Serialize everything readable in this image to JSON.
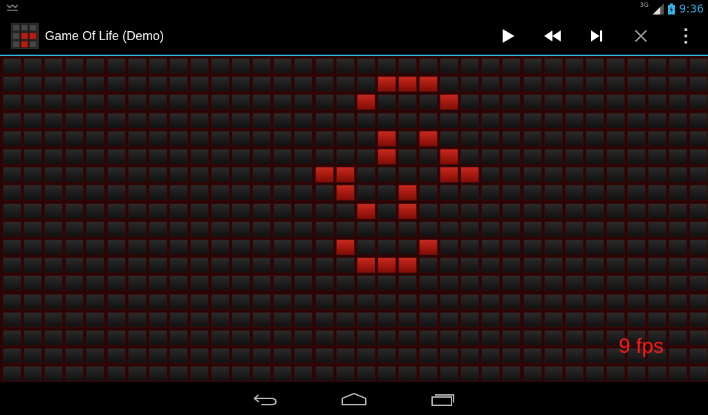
{
  "status_bar": {
    "network": "3G",
    "time": "9:36",
    "icons": [
      "download-icon",
      "signal-icon",
      "battery-charging-icon"
    ]
  },
  "action_bar": {
    "app_icon": "game-of-life-icon",
    "title": "Game Of Life (Demo)",
    "actions": [
      {
        "name": "play",
        "icon": "play-icon"
      },
      {
        "name": "rewind",
        "icon": "rewind-icon"
      },
      {
        "name": "step",
        "icon": "skip-next-icon"
      },
      {
        "name": "clear",
        "icon": "close-icon"
      },
      {
        "name": "overflow",
        "icon": "overflow-menu-icon"
      }
    ],
    "accent_color": "#33b5e5"
  },
  "board": {
    "columns": 34,
    "rows": 18,
    "alive_color": "#b71c12",
    "dead_color": "#222222",
    "alive_cells": [
      [
        1,
        18
      ],
      [
        1,
        19
      ],
      [
        1,
        20
      ],
      [
        2,
        17
      ],
      [
        2,
        21
      ],
      [
        4,
        18
      ],
      [
        4,
        20
      ],
      [
        5,
        18
      ],
      [
        5,
        21
      ],
      [
        6,
        15
      ],
      [
        6,
        16
      ],
      [
        6,
        21
      ],
      [
        6,
        22
      ],
      [
        7,
        16
      ],
      [
        7,
        19
      ],
      [
        8,
        17
      ],
      [
        8,
        19
      ],
      [
        10,
        16
      ],
      [
        10,
        20
      ],
      [
        11,
        17
      ],
      [
        11,
        18
      ],
      [
        11,
        19
      ]
    ],
    "fps_label": "9 fps"
  },
  "nav_bar": {
    "buttons": [
      {
        "name": "back",
        "icon": "back-icon"
      },
      {
        "name": "home",
        "icon": "home-icon"
      },
      {
        "name": "recents",
        "icon": "recent-apps-icon"
      }
    ]
  }
}
